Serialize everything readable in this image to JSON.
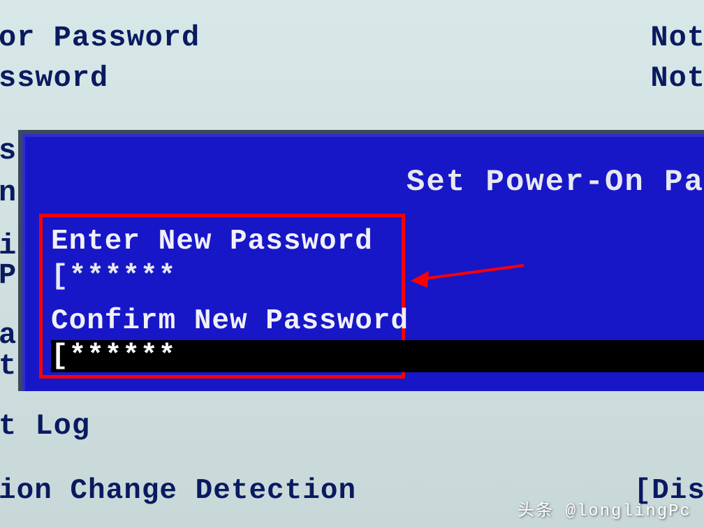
{
  "background": {
    "line1": "or Password",
    "line2": "ssword",
    "status1": "Not",
    "status2": "Not",
    "left_cut1": "st",
    "left_cut2": "n",
    "left_cut3": "i",
    "left_cut4": "P",
    "left_cut5": "a",
    "left_cut6": "t",
    "menu_log": "t Log",
    "menu_detection": "ion Change Detection",
    "right_cut": "[Dis"
  },
  "dialog": {
    "title": "Set Power-On Pa",
    "enter_label": "Enter New Password",
    "enter_value": "[******",
    "confirm_label": "Confirm New Password",
    "confirm_value": "[******"
  },
  "watermark": "头条 @longlingPc",
  "annotation": {
    "arrow_color": "#ff0000",
    "highlight_box_color": "#ff0000"
  }
}
